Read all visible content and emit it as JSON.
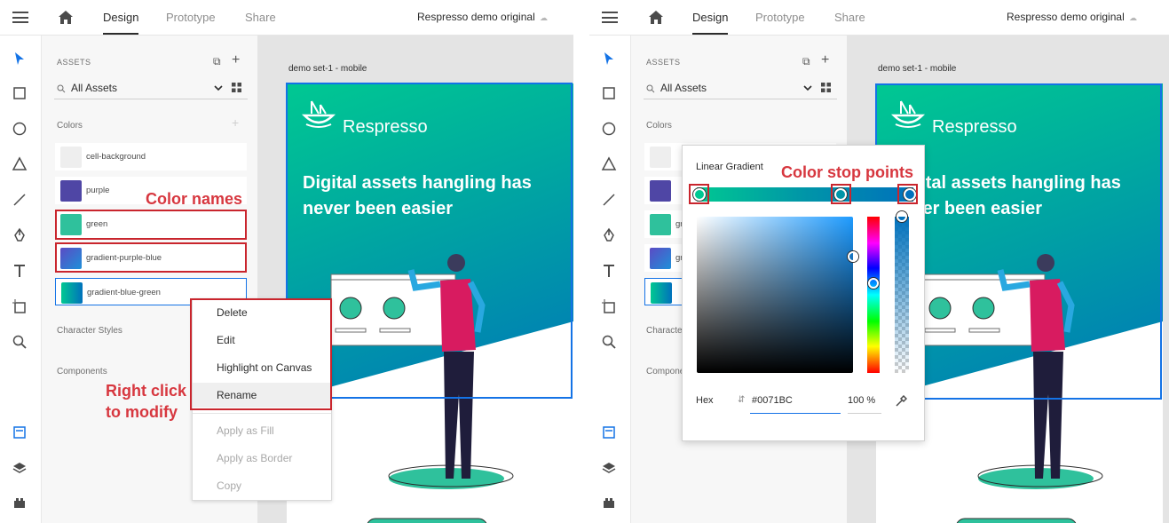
{
  "topbar": {
    "tabs": [
      "Design",
      "Prototype",
      "Share"
    ],
    "doc_title": "Respresso demo original"
  },
  "assets": {
    "header": "ASSETS",
    "filter": "All Assets",
    "colors_label": "Colors",
    "character_styles_label": "Character Styles",
    "components_label": "Components",
    "right_colors_label": "Colors",
    "right_character_label": "Characte",
    "right_components_label": "Compone",
    "colors": [
      {
        "name": "cell-background",
        "swatch": "#eeeeee"
      },
      {
        "name": "purple",
        "swatch": "#4f46a5"
      },
      {
        "name": "green",
        "swatch": "#2fc19c"
      },
      {
        "name": "gradient-purple-blue",
        "swatch": "linear-gradient(135deg,#5b4bc4,#1e90d9)"
      },
      {
        "name": "gradient-blue-green",
        "swatch": "linear-gradient(90deg,#00c892,#0071bc)"
      }
    ],
    "right_partial_names": [
      "gr",
      "gr"
    ]
  },
  "canvas": {
    "artboard_label": "demo set-1 - mobile",
    "brand": "Respresso",
    "headline": "Digital assets hangling has never been easier"
  },
  "context_menu": {
    "items": [
      "Delete",
      "Edit",
      "Highlight on Canvas",
      "Rename",
      "Apply as Fill",
      "Apply as Border",
      "Copy"
    ]
  },
  "annotations": {
    "color_names": "Color names",
    "right_click": "Right click\nto modify",
    "stop_points": "Color stop points"
  },
  "picker": {
    "title": "Linear Gradient",
    "hex_label": "Hex",
    "hex_value": "#0071BC",
    "opacity": "100 %"
  },
  "colors": {
    "accent": "#1473e6",
    "annotation": "#d7373f"
  }
}
